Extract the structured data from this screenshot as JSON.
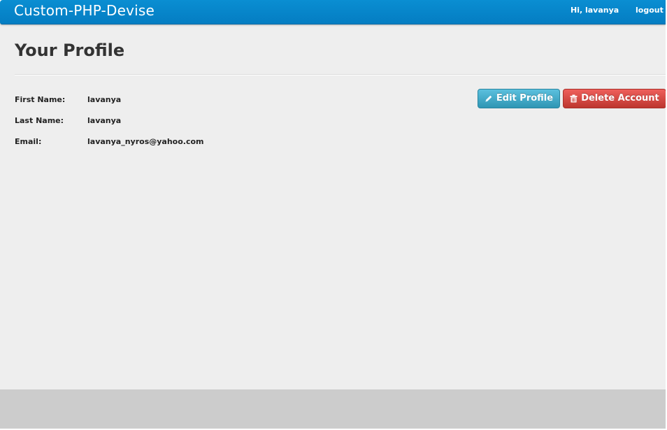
{
  "navbar": {
    "brand": "Custom-PHP-Devise",
    "greeting": "Hi, lavanya",
    "logout_label": "logout"
  },
  "profile": {
    "title": "Your Profile",
    "fields": [
      {
        "label": "First Name:",
        "value": "lavanya"
      },
      {
        "label": "Last Name:",
        "value": "lavanya"
      },
      {
        "label": "Email:",
        "value": "lavanya_nyros@yahoo.com"
      }
    ]
  },
  "actions": {
    "edit_label": "Edit Profile",
    "edit_icon": "pencil-icon",
    "delete_label": "Delete Account",
    "delete_icon": "trash-icon"
  },
  "colors": {
    "navbar": "#047dc2",
    "background": "#eeeeee",
    "footer": "#cccccc",
    "info_button": "#2f96b4",
    "danger_button": "#bd362f"
  }
}
